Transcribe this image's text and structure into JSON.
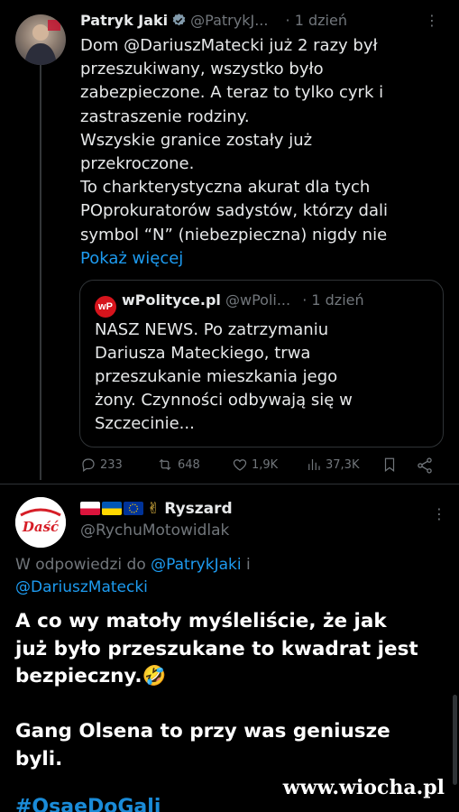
{
  "tweet1": {
    "author_name": "Patryk Jaki",
    "handle": "@PatrykJ...",
    "time": "· 1 dzień",
    "body": "Dom @DariuszMatecki już 2 razy był\nprzeszukiwany, wszystko było\nzabezpieczone. A teraz to tylko cyrk i\nzastraszenie rodziny.\nWszyskie granice zostały już\nprzekroczone.\nTo charkterystyczna akurat dla tych\nPOprokuratorów sadystów, którzy dali\nsymbol “N” (niebezpieczna) nigdy nie",
    "show_more": "Pokaż więcej",
    "quote": {
      "logo_text": "wP",
      "author_name": "wPolityce.pl",
      "handle": "@wPoli...",
      "time": "· 1 dzień",
      "body": "NASZ NEWS. Po zatrzymaniu\nDariusza Mateckiego, trwa\nprzeszukanie mieszkania jego\nżony. Czynności odbywają się w\nSzczecinie..."
    },
    "stats": {
      "replies": "233",
      "reposts": "648",
      "likes": "1,9K",
      "views": "37,3K"
    }
  },
  "tweet2": {
    "author_name": "Ryszard",
    "emoji_prefix": "✌",
    "handle": "@RychuMotowidlak",
    "avatar_text": "Daść",
    "reply_to_label": "W odpowiedzi do",
    "reply_to_1": "@PatrykJaki",
    "reply_to_and": "i",
    "reply_to_2": "@DariuszMatecki",
    "body": "A co wy matoły myśleliście, że jak\njuż było przeszukane to kwadrat jest\nbezpieczny.🤣\n\nGang Olsena to przy was geniusze\nbyli.",
    "cut_tag": "#OsaeDoGali"
  },
  "watermark": "www.wiocha.pl",
  "colors": {
    "background": "#000000",
    "text": "#e7e9ea",
    "muted": "#71767b",
    "link": "#1d9bf0",
    "border": "#2f3336"
  }
}
